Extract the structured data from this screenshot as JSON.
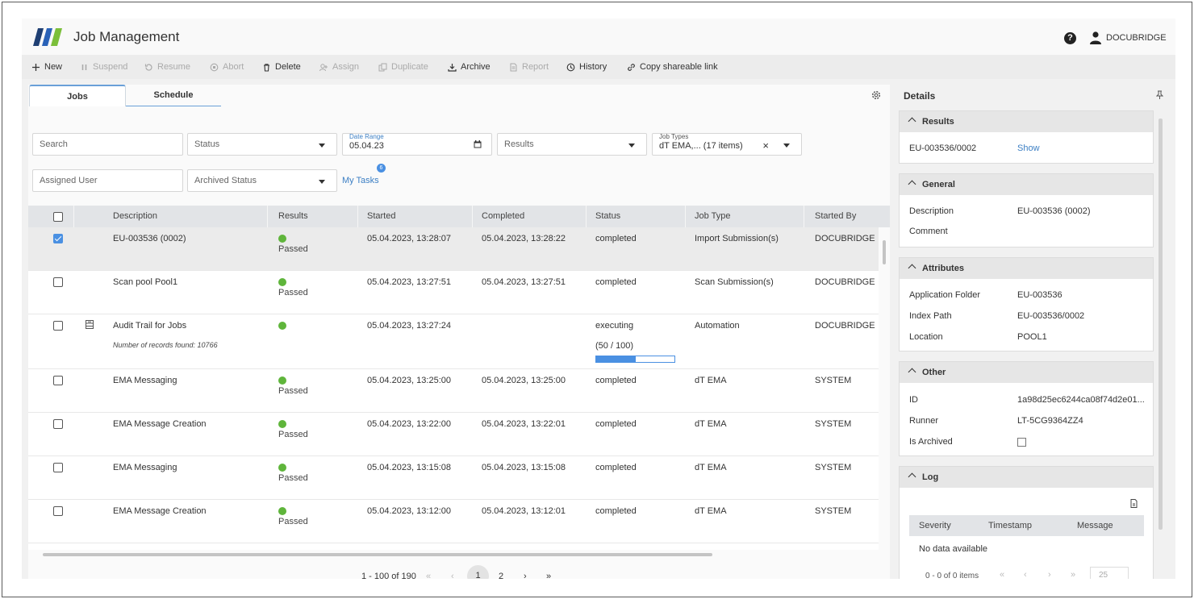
{
  "header": {
    "title": "Job Management",
    "user": "DOCUBRIDGE"
  },
  "toolbar": {
    "new": "New",
    "suspend": "Suspend",
    "resume": "Resume",
    "abort": "Abort",
    "delete": "Delete",
    "assign": "Assign",
    "duplicate": "Duplicate",
    "archive": "Archive",
    "report": "Report",
    "history": "History",
    "copy_link": "Copy shareable link"
  },
  "tabs": {
    "jobs": "Jobs",
    "schedule": "Schedule"
  },
  "filters": {
    "search_placeholder": "Search",
    "status_placeholder": "Status",
    "date_range_label": "Date Range",
    "date_range_value": "05.04.23",
    "results_placeholder": "Results",
    "job_types_label": "Job Types",
    "job_types_value": "dT EMA,... (17 items)",
    "assigned_user_placeholder": "Assigned User",
    "archived_status_placeholder": "Archived Status",
    "my_tasks": "My Tasks",
    "my_tasks_badge": "6"
  },
  "table": {
    "columns": [
      "Description",
      "Results",
      "Started",
      "Completed",
      "Status",
      "Job Type",
      "Started By"
    ],
    "rows": [
      {
        "description": "EU-003536 (0002)",
        "result": "Passed",
        "started": "05.04.2023, 13:28:07",
        "completed": "05.04.2023, 13:28:22",
        "status": "completed",
        "job_type": "Import Submission(s)",
        "started_by": "DOCUBRIDGE"
      },
      {
        "description": "Scan pool Pool1",
        "result": "Passed",
        "started": "05.04.2023, 13:27:51",
        "completed": "05.04.2023, 13:27:51",
        "status": "completed",
        "job_type": "Scan Submission(s)",
        "started_by": "DOCUBRIDGE"
      },
      {
        "description": "Audit Trail for Jobs",
        "sub": "Number of records found: 10766",
        "result": "",
        "started": "05.04.2023, 13:27:24",
        "completed": "",
        "status": "executing",
        "progress_text": "(50 / 100)",
        "progress": 0.5,
        "job_type": "Automation",
        "started_by": "DOCUBRIDGE"
      },
      {
        "description": "EMA Messaging",
        "result": "Passed",
        "started": "05.04.2023, 13:25:00",
        "completed": "05.04.2023, 13:25:00",
        "status": "completed",
        "job_type": "dT EMA",
        "started_by": "SYSTEM"
      },
      {
        "description": "EMA Message Creation",
        "result": "Passed",
        "started": "05.04.2023, 13:22:00",
        "completed": "05.04.2023, 13:22:01",
        "status": "completed",
        "job_type": "dT EMA",
        "started_by": "SYSTEM"
      },
      {
        "description": "EMA Messaging",
        "result": "Passed",
        "started": "05.04.2023, 13:15:08",
        "completed": "05.04.2023, 13:15:08",
        "status": "completed",
        "job_type": "dT EMA",
        "started_by": "SYSTEM"
      },
      {
        "description": "EMA Message Creation",
        "result": "Passed",
        "started": "05.04.2023, 13:12:00",
        "completed": "05.04.2023, 13:12:01",
        "status": "completed",
        "job_type": "dT EMA",
        "started_by": "SYSTEM"
      }
    ]
  },
  "pager": {
    "range": "1 - 100 of 190",
    "page1": "1",
    "page2": "2"
  },
  "details": {
    "title": "Details",
    "results": {
      "title": "Results",
      "id": "EU-003536/0002",
      "show": "Show"
    },
    "general": {
      "title": "General",
      "description_label": "Description",
      "description_value": "EU-003536 (0002)",
      "comment_label": "Comment"
    },
    "attributes": {
      "title": "Attributes",
      "app_folder_label": "Application Folder",
      "app_folder_value": "EU-003536",
      "index_path_label": "Index Path",
      "index_path_value": "EU-003536/0002",
      "location_label": "Location",
      "location_value": "POOL1"
    },
    "other": {
      "title": "Other",
      "id_label": "ID",
      "id_value": "1a98d25ec6244ca08f74d2e01...",
      "runner_label": "Runner",
      "runner_value": "LT-5CG9364ZZ4",
      "archived_label": "Is Archived"
    },
    "log": {
      "title": "Log",
      "severity": "Severity",
      "timestamp": "Timestamp",
      "message": "Message",
      "empty": "No data available",
      "range": "0 - 0 of 0 items",
      "page_size": "25"
    }
  }
}
